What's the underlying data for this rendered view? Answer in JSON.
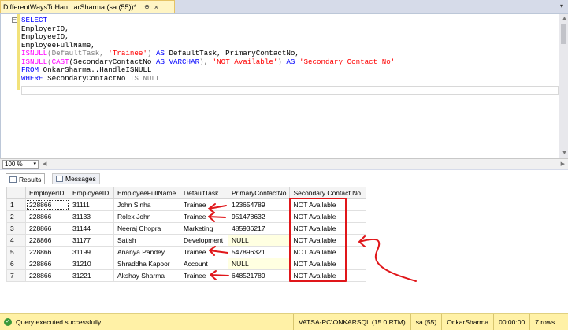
{
  "tab": {
    "title": "DifferentWaysToHan...arSharma (sa (55))*",
    "pin": "⊕",
    "close": "×"
  },
  "editor": {
    "collapse": "−",
    "lines": [
      [
        {
          "t": "SELECT",
          "c": "kw"
        }
      ],
      [
        {
          "t": "EmployerID,",
          "c": ""
        }
      ],
      [
        {
          "t": "EmployeeID,",
          "c": ""
        }
      ],
      [
        {
          "t": "EmployeeFullName,",
          "c": ""
        }
      ],
      [
        {
          "t": "ISNULL",
          "c": "fn"
        },
        {
          "t": "(DefaultTask, ",
          "c": "gray"
        },
        {
          "t": "'Trainee'",
          "c": "str"
        },
        {
          "t": ") ",
          "c": "gray"
        },
        {
          "t": "AS",
          "c": "kw"
        },
        {
          "t": " DefaultTask, PrimaryContactNo,",
          "c": ""
        }
      ],
      [
        {
          "t": "ISNULL",
          "c": "fn"
        },
        {
          "t": "(",
          "c": "gray"
        },
        {
          "t": "CAST",
          "c": "fn"
        },
        {
          "t": "(SecondaryContactNo ",
          "c": ""
        },
        {
          "t": "AS",
          "c": "kw"
        },
        {
          "t": " ",
          "c": ""
        },
        {
          "t": "VARCHAR",
          "c": "kw"
        },
        {
          "t": "), ",
          "c": "gray"
        },
        {
          "t": "'NOT Available'",
          "c": "str"
        },
        {
          "t": ") ",
          "c": "gray"
        },
        {
          "t": "AS",
          "c": "kw"
        },
        {
          "t": " ",
          "c": ""
        },
        {
          "t": "'Secondary Contact No'",
          "c": "str"
        }
      ],
      [
        {
          "t": "FROM",
          "c": "kw"
        },
        {
          "t": " OnkarSharma..HandleISNULL",
          "c": ""
        }
      ],
      [
        {
          "t": "WHERE",
          "c": "kw"
        },
        {
          "t": " SecondaryContactNo ",
          "c": ""
        },
        {
          "t": "IS NULL",
          "c": "gray"
        }
      ]
    ]
  },
  "zoom": {
    "value": "100 %",
    "arrow": "▾"
  },
  "results": {
    "tabs": {
      "results": "Results",
      "messages": "Messages"
    },
    "columns": [
      "",
      "EmployerID",
      "EmployeeID",
      "EmployeeFullName",
      "DefaultTask",
      "PrimaryContactNo",
      "Secondary Contact No"
    ],
    "rows": [
      [
        "1",
        "228866",
        "31111",
        "John Sinha",
        "Trainee",
        "123654789",
        "NOT Available"
      ],
      [
        "2",
        "228866",
        "31133",
        "Rolex John",
        "Trainee",
        "951478632",
        "NOT Available"
      ],
      [
        "3",
        "228866",
        "31144",
        "Neeraj Chopra",
        "Marketing",
        "485936217",
        "NOT Available"
      ],
      [
        "4",
        "228866",
        "31177",
        "Satish",
        "Development",
        "NULL",
        "NOT Available"
      ],
      [
        "5",
        "228866",
        "31199",
        "Ananya Pandey",
        "Trainee",
        "547896321",
        "NOT Available"
      ],
      [
        "6",
        "228866",
        "31210",
        "Shraddha Kapoor",
        "Account",
        "NULL",
        "NOT Available"
      ],
      [
        "7",
        "228866",
        "31221",
        "Akshay Sharma",
        "Trainee",
        "648521789",
        "NOT Available"
      ]
    ]
  },
  "status": {
    "message": "Query executed successfully.",
    "server": "VATSA-PC\\ONKARSQL (15.0 RTM)",
    "user": "sa (55)",
    "database": "OnkarSharma",
    "time": "00:00:00",
    "rows": "7 rows"
  },
  "colors": {
    "annotation_red": "#e0161a",
    "status_bar": "#fff1a6",
    "tab_active": "#fff5c4"
  }
}
